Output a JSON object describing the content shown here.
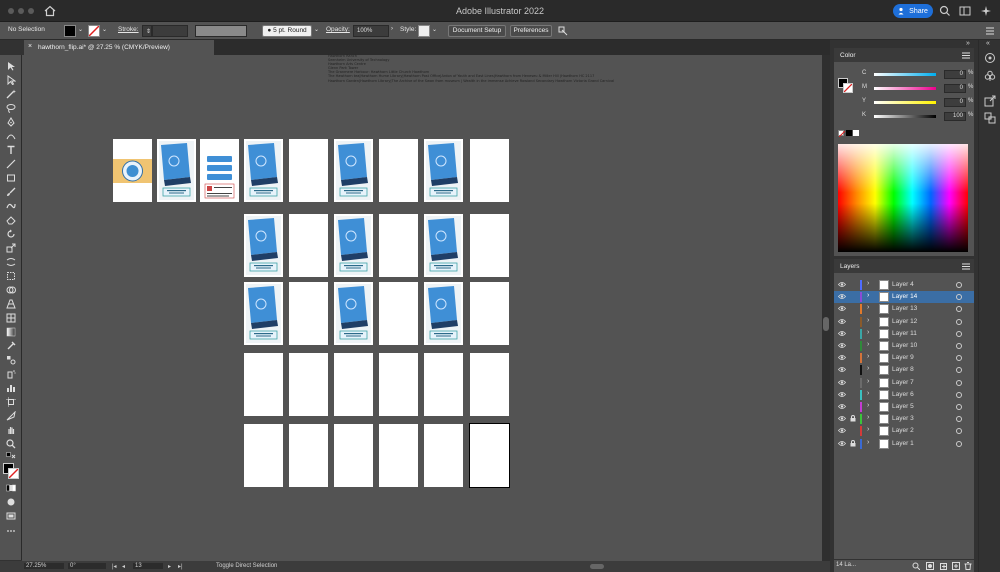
{
  "titlebar": {
    "title": "Adobe Illustrator 2022",
    "share_label": "Share"
  },
  "control_bar": {
    "selection": "No Selection",
    "stroke_label": "Stroke:",
    "brush": "5 pt. Round",
    "opacity_label": "Opacity:",
    "opacity_value": "100%",
    "style_label": "Style:",
    "document_setup": "Document Setup",
    "preferences": "Preferences"
  },
  "document_tab": {
    "close": "×",
    "label": "hawthorn_flip.ai* @ 27.25 % (CMYK/Preview)"
  },
  "document_text": [
    "Hawthorn Ranch",
    "Seenheim University of Technology",
    "Hawthorn Arts Centre",
    "Glenn Park Tower",
    "The Granmere Harbour: Hawthorn Little Church Hawthorn",
    "The Hawthorn tea|Hawthorn Hume Library|Hawthorn Post Office|Ardon of Youth and East Lines|Hawthorn from Heneseu & Miller Hill (Hawthorn HC 2117",
    "Hawthorn Garden|Hawthorn Library|The Archive of the Swan from museum | Wealth in the immense Achieve Rowland Secondary Hawthorn Victoria Grand Carnival"
  ],
  "status_bar": {
    "zoom": "27.25%",
    "rotation": "0°",
    "artboard_number": "13",
    "hint": "Toggle Direct Selection"
  },
  "color_panel": {
    "title": "Color",
    "channels": [
      {
        "label": "C",
        "value": "0",
        "unit": "%",
        "gradient": "#00aeef"
      },
      {
        "label": "M",
        "value": "0",
        "unit": "%",
        "gradient": "#ec008c"
      },
      {
        "label": "Y",
        "value": "0",
        "unit": "%",
        "gradient": "#fff200"
      },
      {
        "label": "K",
        "value": "100",
        "unit": "%",
        "gradient": "#000000"
      }
    ]
  },
  "layers_panel": {
    "title": "Layers",
    "footer": "14 La...",
    "layers": [
      {
        "name": "Layer 4",
        "color": "#4f6cff",
        "locked": false,
        "active": false
      },
      {
        "name": "Layer 14",
        "color": "#8a4bd6",
        "locked": false,
        "active": true
      },
      {
        "name": "Layer 13",
        "color": "#e07a2c",
        "locked": false,
        "active": false
      },
      {
        "name": "Layer 12",
        "color": "#8a5a2b",
        "locked": false,
        "active": false
      },
      {
        "name": "Layer 11",
        "color": "#3aa6a6",
        "locked": false,
        "active": false
      },
      {
        "name": "Layer 10",
        "color": "#2f8a3a",
        "locked": false,
        "active": false
      },
      {
        "name": "Layer 9",
        "color": "#d4733a",
        "locked": false,
        "active": false
      },
      {
        "name": "Layer 8",
        "color": "#111111",
        "locked": false,
        "active": false
      },
      {
        "name": "Layer 7",
        "color": "#6b6b6b",
        "locked": false,
        "active": false
      },
      {
        "name": "Layer 6",
        "color": "#3ac0c0",
        "locked": false,
        "active": false
      },
      {
        "name": "Layer 5",
        "color": "#c43ad4",
        "locked": false,
        "active": false
      },
      {
        "name": "Layer 3",
        "color": "#3ac43a",
        "locked": true,
        "active": false
      },
      {
        "name": "Layer 2",
        "color": "#d43a3a",
        "locked": false,
        "active": false
      },
      {
        "name": "Layer 1",
        "color": "#3a6ad4",
        "locked": true,
        "active": false
      }
    ]
  }
}
